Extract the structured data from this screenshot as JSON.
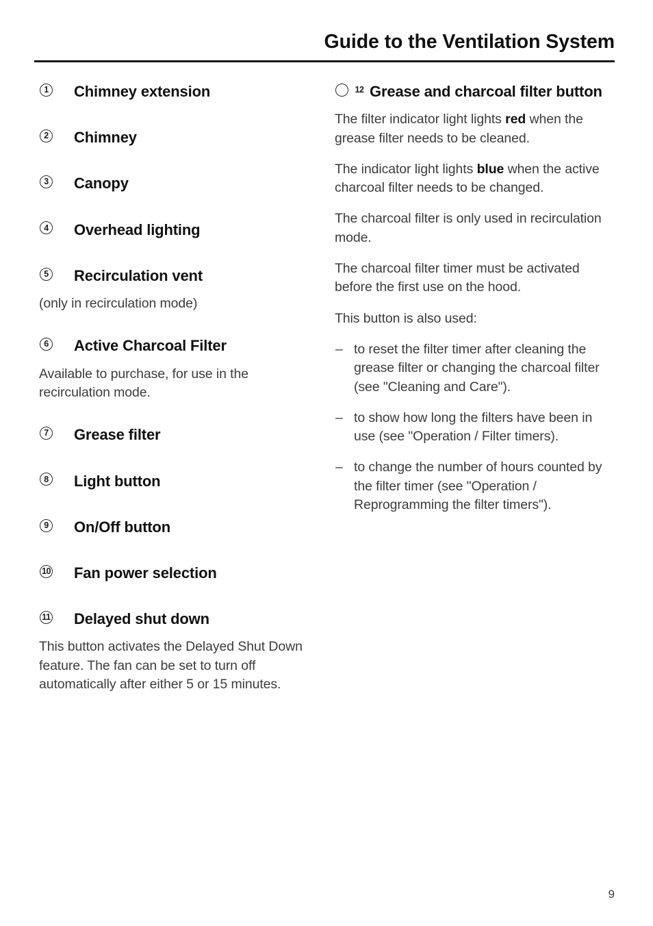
{
  "header": {
    "title": "Guide to the Ventilation System"
  },
  "left_column": {
    "items": [
      {
        "number": "1",
        "label": "Chimney extension"
      },
      {
        "number": "2",
        "label": "Chimney"
      },
      {
        "number": "3",
        "label": "Canopy"
      },
      {
        "number": "4",
        "label": "Overhead lighting"
      },
      {
        "number": "5",
        "label": "Recirculation vent"
      },
      {
        "number": "6",
        "label": "Active Charcoal Filter"
      },
      {
        "number": "7",
        "label": "Grease filter"
      },
      {
        "number": "8",
        "label": "Light button"
      },
      {
        "number": "9",
        "label": "On/Off button"
      },
      {
        "number": "10",
        "label": "Fan power selection"
      },
      {
        "number": "11",
        "label": "Delayed shut down"
      }
    ],
    "note_recirculation_vent": "(only in recirculation mode)",
    "note_active_charcoal_filter": "Available to purchase, for use in the recirculation mode.",
    "note_delayed_shut_down": "This button activates the Delayed Shut Down feature. The fan can be set to turn off automatically after either 5 or 15 minutes."
  },
  "right_column": {
    "heading": {
      "number": "12",
      "label": "Grease and charcoal filter button"
    },
    "paragraphs": {
      "p1_before": "The filter indicator light lights ",
      "p1_bold": "red",
      "p1_after": " when the grease filter needs to be cleaned.",
      "p2_before": "The indicator light lights ",
      "p2_bold": "blue",
      "p2_after": " when the active charcoal filter needs to be changed.",
      "p3": "The charcoal filter is only used in recirculation mode.",
      "p4": "The charcoal filter timer must be activated before the first use on the hood.",
      "p5": "This button is also used:"
    },
    "dash_marker": "–",
    "bullets": [
      "to reset the filter timer after cleaning the grease filter or changing the charcoal filter (see \"Cleaning and Care\").",
      "to show how long the filters have been in use (see \"Operation / Filter timers).",
      "to change the number of hours counted by the filter timer (see \"Operation / Reprogramming the filter timers\")."
    ]
  },
  "footer": {
    "page_number": "9"
  }
}
